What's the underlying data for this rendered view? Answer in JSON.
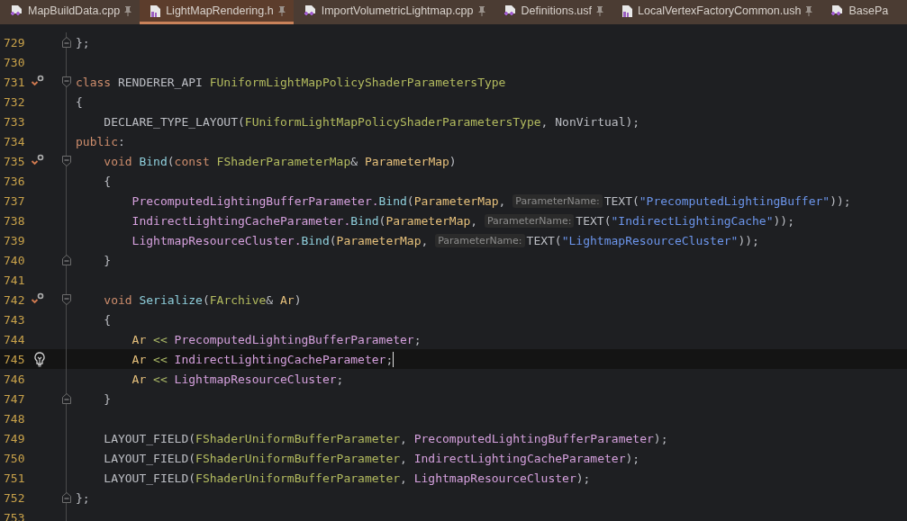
{
  "tabs": [
    {
      "label": "MapBuildData.cpp",
      "kind": "cpp",
      "selected": false,
      "pinned": true
    },
    {
      "label": "LightMapRendering.h",
      "kind": "h",
      "selected": true,
      "pinned": true
    },
    {
      "label": "ImportVolumetricLightmap.cpp",
      "kind": "cpp",
      "selected": false,
      "pinned": true
    },
    {
      "label": "Definitions.usf",
      "kind": "cpp",
      "selected": false,
      "pinned": true
    },
    {
      "label": "LocalVertexFactoryCommon.ush",
      "kind": "h",
      "selected": false,
      "pinned": true
    },
    {
      "label": "BasePa",
      "kind": "cpp",
      "selected": false,
      "pinned": false
    }
  ],
  "lines": [
    {
      "number": "729",
      "fold_close": true,
      "current": false,
      "code": [
        {
          "kind": "plain",
          "text": "};"
        }
      ]
    },
    {
      "number": "730",
      "current": false
    },
    {
      "number": "731",
      "fold_open": true,
      "override": true,
      "current": false,
      "code": [
        {
          "kind": "kw",
          "text": "class "
        },
        {
          "kind": "plain",
          "text": "RENDERER_API "
        },
        {
          "kind": "type",
          "text": "FUniformLightMapPolicyShaderParametersType"
        }
      ]
    },
    {
      "number": "732",
      "current": false,
      "code": [
        {
          "kind": "plain",
          "text": "{"
        }
      ]
    },
    {
      "number": "733",
      "current": false,
      "code": [
        {
          "kind": "plain",
          "text": "    DECLARE_TYPE_LAYOUT("
        },
        {
          "kind": "type",
          "text": "FUniformLightMapPolicyShaderParametersType"
        },
        {
          "kind": "plain",
          "text": ", NonVirtual);"
        }
      ]
    },
    {
      "number": "734",
      "current": false,
      "code": [
        {
          "kind": "kw",
          "text": "public"
        },
        {
          "kind": "plain",
          "text": ":"
        }
      ]
    },
    {
      "number": "735",
      "fold_open": true,
      "override": true,
      "current": false,
      "code": [
        {
          "kind": "kw",
          "text": "    void "
        },
        {
          "kind": "func",
          "text": "Bind"
        },
        {
          "kind": "plain",
          "text": "("
        },
        {
          "kind": "kw",
          "text": "const "
        },
        {
          "kind": "type",
          "text": "FShaderParameterMap"
        },
        {
          "kind": "plain",
          "text": "& "
        },
        {
          "kind": "param",
          "text": "ParameterMap"
        },
        {
          "kind": "plain",
          "text": ")"
        }
      ]
    },
    {
      "number": "736",
      "current": false,
      "code": [
        {
          "kind": "plain",
          "text": "    {"
        }
      ]
    },
    {
      "number": "737",
      "current": false,
      "code": [
        {
          "kind": "member",
          "text": "        PrecomputedLightingBufferParameter."
        },
        {
          "kind": "func",
          "text": "Bind"
        },
        {
          "kind": "plain",
          "text": "("
        },
        {
          "kind": "param",
          "text": "ParameterMap"
        },
        {
          "kind": "plain",
          "text": ", "
        },
        {
          "kind": "hint",
          "text": "ParameterName:"
        },
        {
          "kind": "plain",
          "text": "TEXT("
        },
        {
          "kind": "str",
          "text": "\"PrecomputedLightingBuffer\""
        },
        {
          "kind": "plain",
          "text": "));"
        }
      ]
    },
    {
      "number": "738",
      "current": false,
      "code": [
        {
          "kind": "member",
          "text": "        IndirectLightingCacheParameter."
        },
        {
          "kind": "func",
          "text": "Bind"
        },
        {
          "kind": "plain",
          "text": "("
        },
        {
          "kind": "param",
          "text": "ParameterMap"
        },
        {
          "kind": "plain",
          "text": ", "
        },
        {
          "kind": "hint",
          "text": "ParameterName:"
        },
        {
          "kind": "plain",
          "text": "TEXT("
        },
        {
          "kind": "str",
          "text": "\"IndirectLightingCache\""
        },
        {
          "kind": "plain",
          "text": "));"
        }
      ]
    },
    {
      "number": "739",
      "current": false,
      "code": [
        {
          "kind": "member",
          "text": "        LightmapResourceCluster."
        },
        {
          "kind": "func",
          "text": "Bind"
        },
        {
          "kind": "plain",
          "text": "("
        },
        {
          "kind": "param",
          "text": "ParameterMap"
        },
        {
          "kind": "plain",
          "text": ", "
        },
        {
          "kind": "hint",
          "text": "ParameterName:"
        },
        {
          "kind": "plain",
          "text": "TEXT("
        },
        {
          "kind": "str",
          "text": "\"LightmapResourceCluster\""
        },
        {
          "kind": "plain",
          "text": "));"
        }
      ]
    },
    {
      "number": "740",
      "fold_close": true,
      "current": false,
      "code": [
        {
          "kind": "plain",
          "text": "    }"
        }
      ]
    },
    {
      "number": "741",
      "current": false
    },
    {
      "number": "742",
      "fold_open": true,
      "override": true,
      "current": false,
      "code": [
        {
          "kind": "kw",
          "text": "    void "
        },
        {
          "kind": "func",
          "text": "Serialize"
        },
        {
          "kind": "plain",
          "text": "("
        },
        {
          "kind": "type",
          "text": "FArchive"
        },
        {
          "kind": "plain",
          "text": "& "
        },
        {
          "kind": "param",
          "text": "Ar"
        },
        {
          "kind": "plain",
          "text": ")"
        }
      ]
    },
    {
      "number": "743",
      "current": false,
      "code": [
        {
          "kind": "plain",
          "text": "    {"
        }
      ]
    },
    {
      "number": "744",
      "current": false,
      "code": [
        {
          "kind": "param",
          "text": "        Ar "
        },
        {
          "kind": "op",
          "text": "<< "
        },
        {
          "kind": "member",
          "text": "PrecomputedLightingBufferParameter"
        },
        {
          "kind": "plain",
          "text": ";"
        }
      ]
    },
    {
      "number": "745",
      "bulb": true,
      "current": true,
      "code": [
        {
          "kind": "param",
          "text": "        Ar "
        },
        {
          "kind": "op",
          "text": "<< "
        },
        {
          "kind": "member",
          "text": "IndirectLightingCacheParameter"
        },
        {
          "kind": "plain",
          "text": ";"
        }
      ]
    },
    {
      "number": "746",
      "current": false,
      "code": [
        {
          "kind": "param",
          "text": "        Ar "
        },
        {
          "kind": "op",
          "text": "<< "
        },
        {
          "kind": "member",
          "text": "LightmapResourceCluster"
        },
        {
          "kind": "plain",
          "text": ";"
        }
      ]
    },
    {
      "number": "747",
      "fold_close": true,
      "current": false,
      "code": [
        {
          "kind": "plain",
          "text": "    }"
        }
      ]
    },
    {
      "number": "748",
      "current": false
    },
    {
      "number": "749",
      "current": false,
      "code": [
        {
          "kind": "plain",
          "text": "    LAYOUT_FIELD("
        },
        {
          "kind": "type",
          "text": "FShaderUniformBufferParameter"
        },
        {
          "kind": "plain",
          "text": ", "
        },
        {
          "kind": "member",
          "text": "PrecomputedLightingBufferParameter"
        },
        {
          "kind": "plain",
          "text": ");"
        }
      ]
    },
    {
      "number": "750",
      "current": false,
      "code": [
        {
          "kind": "plain",
          "text": "    LAYOUT_FIELD("
        },
        {
          "kind": "type",
          "text": "FShaderUniformBufferParameter"
        },
        {
          "kind": "plain",
          "text": ", "
        },
        {
          "kind": "member",
          "text": "IndirectLightingCacheParameter"
        },
        {
          "kind": "plain",
          "text": ");"
        }
      ]
    },
    {
      "number": "751",
      "current": false,
      "code": [
        {
          "kind": "plain",
          "text": "    LAYOUT_FIELD("
        },
        {
          "kind": "type",
          "text": "FShaderUniformBufferParameter"
        },
        {
          "kind": "plain",
          "text": ", "
        },
        {
          "kind": "member",
          "text": "LightmapResourceCluster"
        },
        {
          "kind": "plain",
          "text": ");"
        }
      ]
    },
    {
      "number": "752",
      "fold_close": true,
      "current": false,
      "code": [
        {
          "kind": "plain",
          "text": "};"
        }
      ]
    },
    {
      "number": "753",
      "current": false
    }
  ]
}
